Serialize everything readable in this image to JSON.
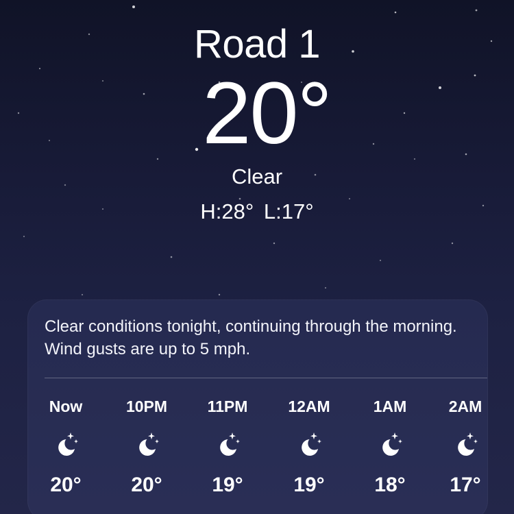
{
  "header": {
    "location": "Road 1",
    "temperature": "20°",
    "condition": "Clear",
    "high_low": "H:28° L:17°"
  },
  "hourly_card": {
    "summary": "Clear conditions tonight, continuing through the morning. Wind gusts are up to 5 mph.",
    "hours": [
      {
        "label": "Now",
        "icon": "moon-stars-icon",
        "temp": "20°"
      },
      {
        "label": "10PM",
        "icon": "moon-stars-icon",
        "temp": "20°"
      },
      {
        "label": "11PM",
        "icon": "moon-stars-icon",
        "temp": "19°"
      },
      {
        "label": "12AM",
        "icon": "moon-stars-icon",
        "temp": "19°"
      },
      {
        "label": "1AM",
        "icon": "moon-stars-icon",
        "temp": "18°"
      },
      {
        "label": "2AM",
        "icon": "moon-stars-icon",
        "temp": "17°"
      }
    ]
  },
  "colors": {
    "background_top": "#101327",
    "background_bottom": "#232649",
    "text": "#ffffff"
  }
}
